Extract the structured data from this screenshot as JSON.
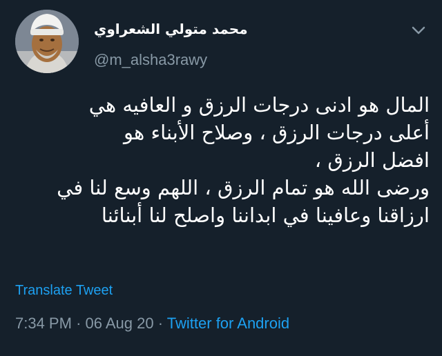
{
  "author": {
    "display_name": "محمد متولي الشعراوي",
    "handle": "@m_alsha3rawy"
  },
  "tweet": {
    "lines": [
      "المال هو ادنى درجات الرزق و العافيه هي",
      "أعلى درجات الرزق ، وصلاح الأبناء هو",
      "افضل الرزق ،",
      "ورضى الله هو تمام الرزق ، اللهم وسع لنا في",
      "ارزاقنا وعافينا في ابداننا واصلح لنا أبنائنا"
    ],
    "translate_label": "Translate Tweet",
    "time": "7:34 PM",
    "separator": "·",
    "date": "06 Aug 20",
    "source": "Twitter for Android"
  },
  "icons": {
    "menu": "chevron-down-icon",
    "avatar": "profile-photo"
  },
  "colors": {
    "background": "#15202b",
    "text": "#ffffff",
    "secondary": "#8899a6",
    "accent": "#1da1f2"
  }
}
